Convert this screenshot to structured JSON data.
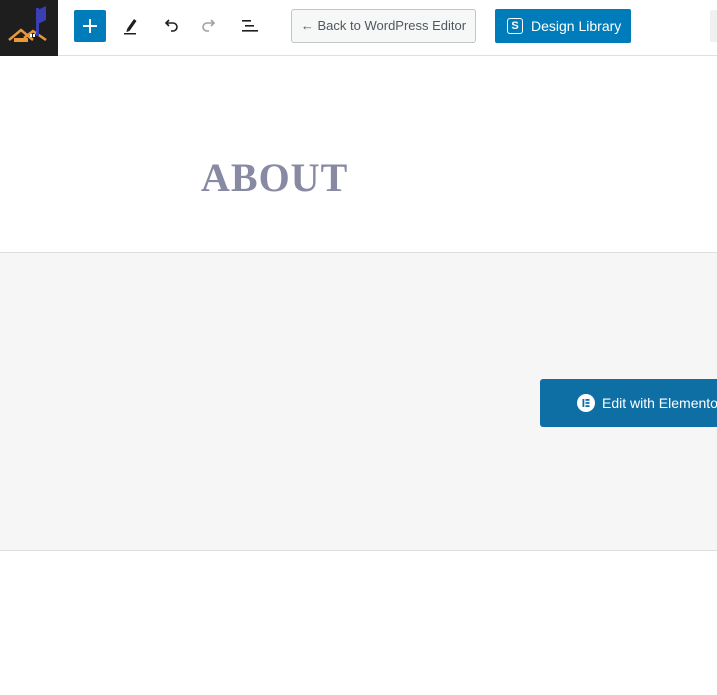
{
  "toolbar": {
    "back_label": "← Back to WordPress Editor",
    "library_label": "Design Library",
    "library_icon_letter": "S",
    "icons": {
      "logo": "site-logo-house",
      "add": "plus-icon",
      "tools": "pencil-icon",
      "undo": "undo-icon",
      "redo": "redo-icon",
      "outline": "list-view-icon"
    }
  },
  "page": {
    "title": "ABOUT"
  },
  "editor": {
    "elementor_label": "Edit with Elementor",
    "elementor_icon": "elementor-logo-icon"
  },
  "colors": {
    "accent": "#007cba",
    "elementor_button": "#0e6fa5",
    "title": "#888aa3",
    "logo_bg": "#1e1e1e"
  }
}
